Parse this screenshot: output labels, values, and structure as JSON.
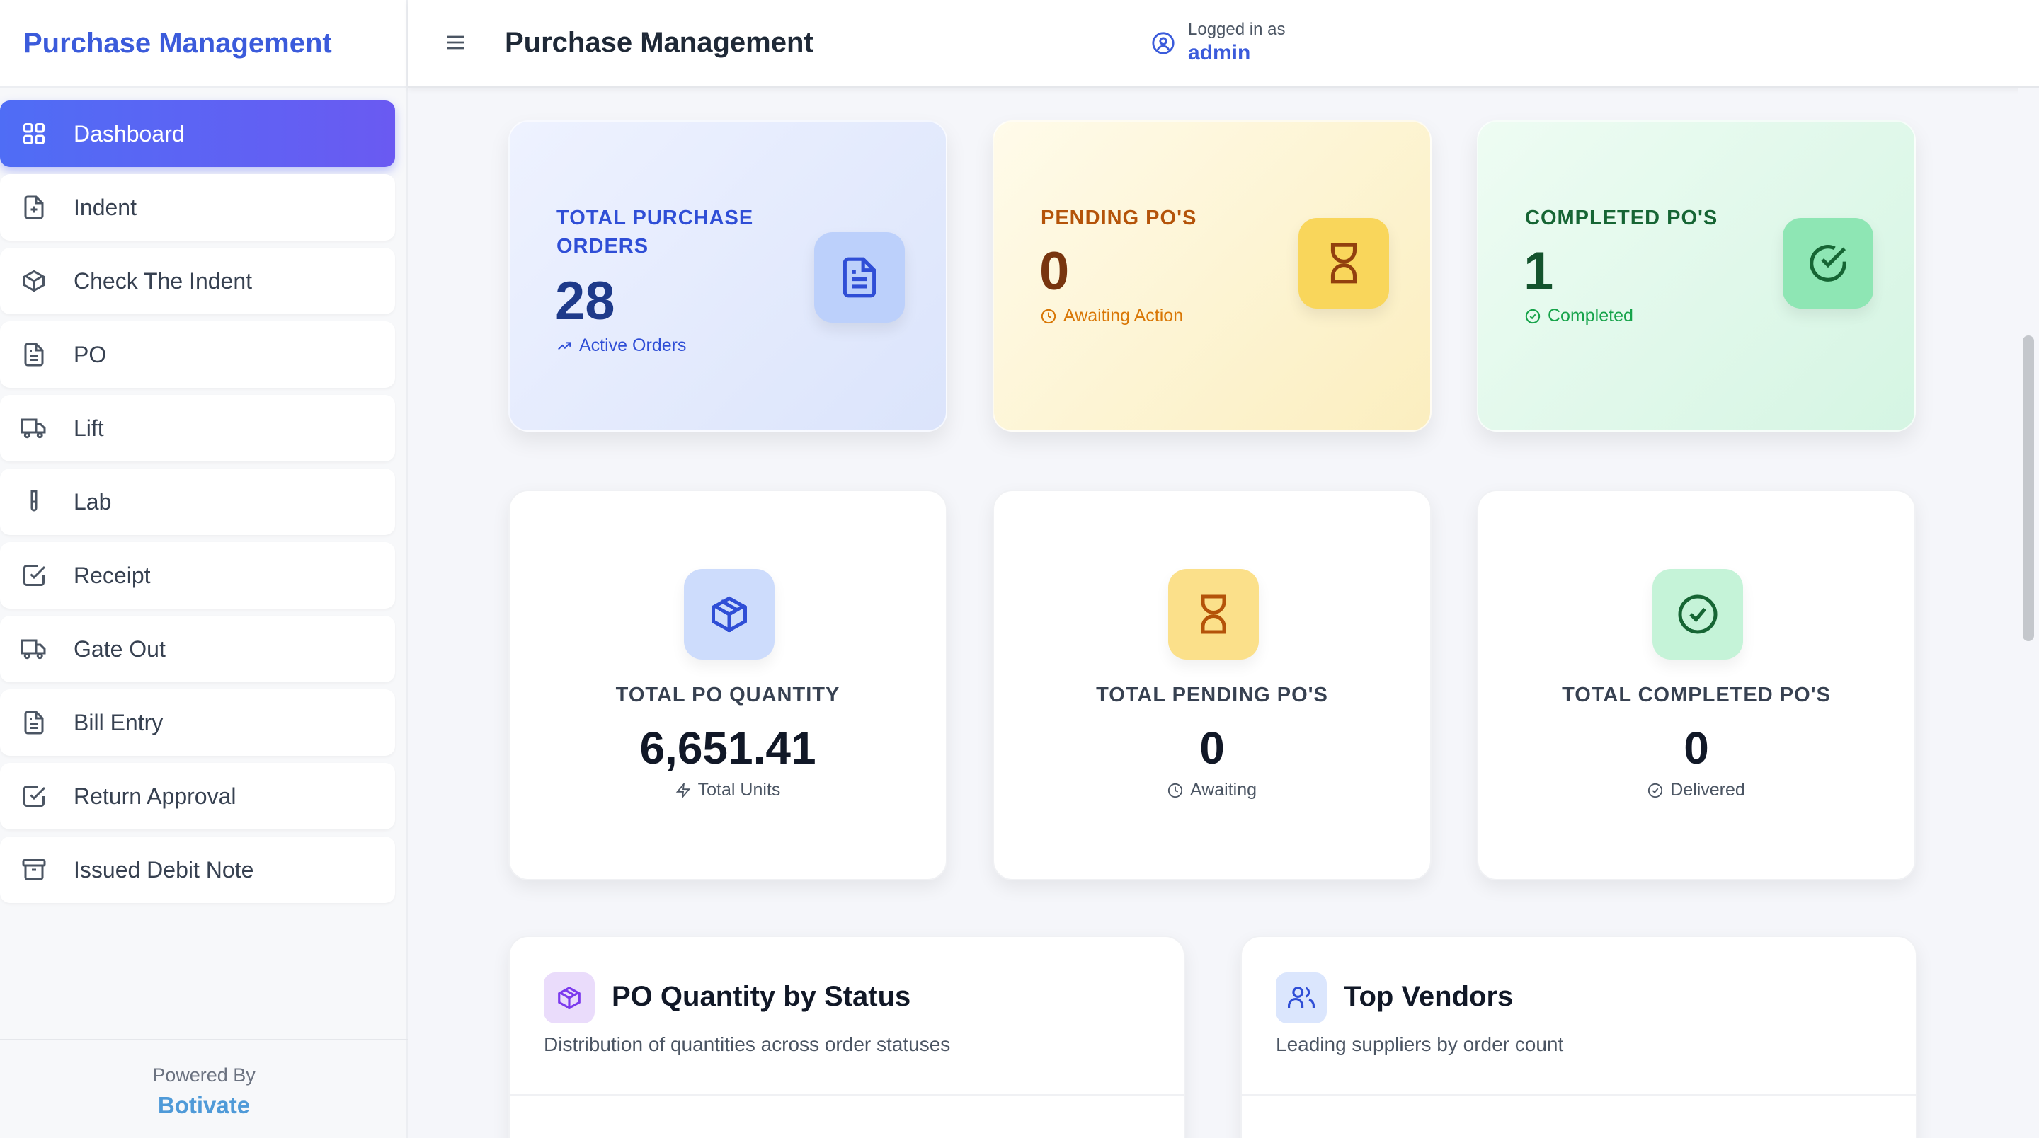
{
  "sidebar": {
    "brand": "Purchase Management",
    "items": [
      {
        "label": "Dashboard",
        "icon": "dashboard-grid-icon"
      },
      {
        "label": "Indent",
        "icon": "file-plus-icon"
      },
      {
        "label": "Check The Indent",
        "icon": "package-icon"
      },
      {
        "label": "PO",
        "icon": "document-icon"
      },
      {
        "label": "Lift",
        "icon": "truck-icon"
      },
      {
        "label": "Lab",
        "icon": "test-tube-icon"
      },
      {
        "label": "Receipt",
        "icon": "check-square-icon"
      },
      {
        "label": "Gate Out",
        "icon": "truck-icon"
      },
      {
        "label": "Bill Entry",
        "icon": "document-icon"
      },
      {
        "label": "Return Approval",
        "icon": "check-square-icon"
      },
      {
        "label": "Issued Debit Note",
        "icon": "archive-icon"
      }
    ],
    "footer": {
      "powered_by": "Powered By",
      "company": "Botivate"
    }
  },
  "header": {
    "title": "Purchase Management",
    "logged_in_label": "Logged in as",
    "username": "admin"
  },
  "stats": [
    {
      "label": "TOTAL PURCHASE ORDERS",
      "value": "28",
      "sub": "Active Orders",
      "icon": "document-icon",
      "accent": "#2f4ed6"
    },
    {
      "label": "PENDING PO'S",
      "value": "0",
      "sub": "Awaiting Action",
      "icon": "hourglass-icon",
      "accent": "#b45309"
    },
    {
      "label": "COMPLETED PO'S",
      "value": "1",
      "sub": "Completed",
      "icon": "check-circle-icon",
      "accent": "#166534"
    }
  ],
  "summary": [
    {
      "label": "TOTAL PO QUANTITY",
      "value": "6,651.41",
      "sub": "Total Units",
      "icon": "package-icon"
    },
    {
      "label": "TOTAL PENDING PO'S",
      "value": "0",
      "sub": "Awaiting",
      "icon": "hourglass-icon"
    },
    {
      "label": "TOTAL COMPLETED PO'S",
      "value": "0",
      "sub": "Delivered",
      "icon": "check-circle-icon"
    }
  ],
  "panels": [
    {
      "title": "PO Quantity by Status",
      "subtitle": "Distribution of quantities across order statuses",
      "icon": "package-icon"
    },
    {
      "title": "Top Vendors",
      "subtitle": "Leading suppliers by order count",
      "icon": "users-icon"
    }
  ]
}
